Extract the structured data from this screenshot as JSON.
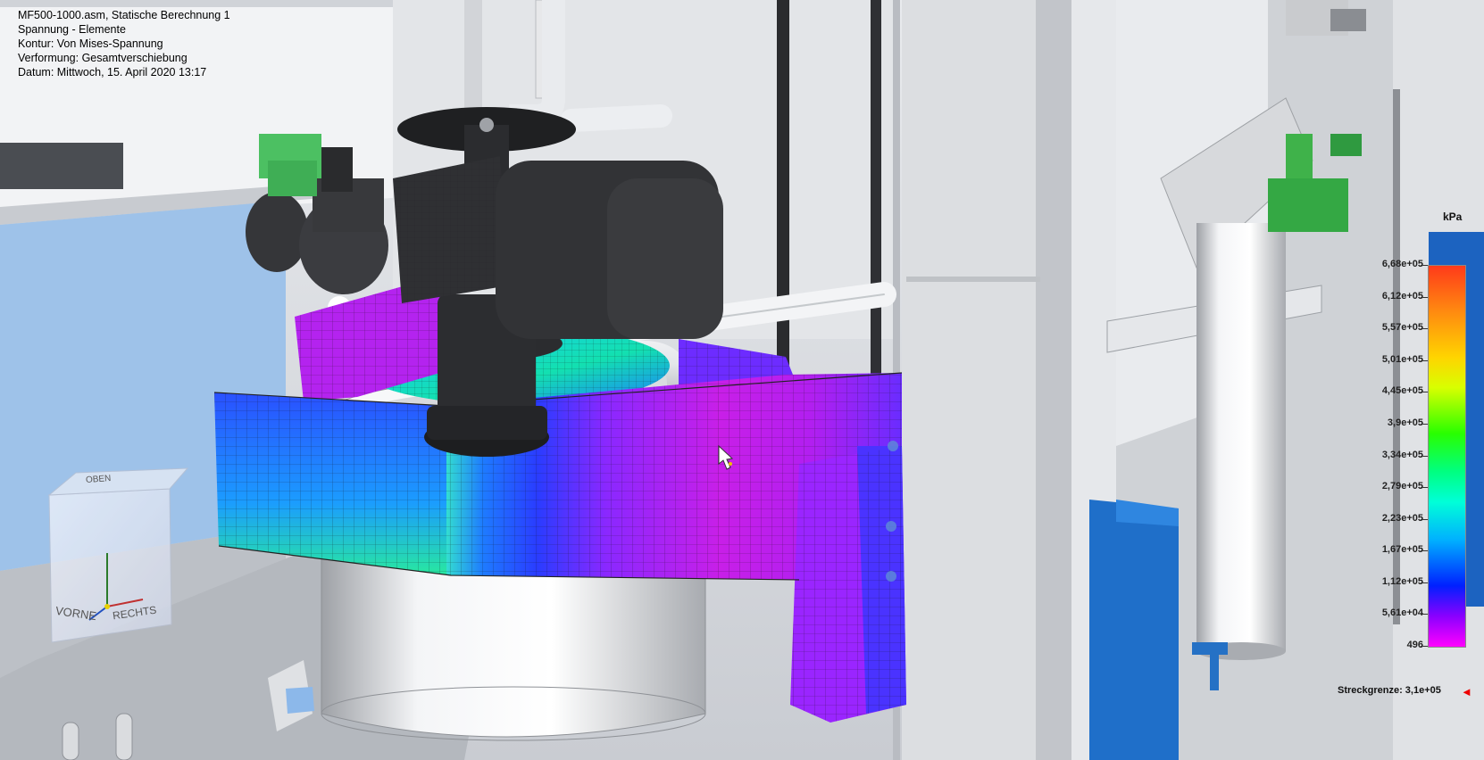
{
  "header": {
    "line1": "MF500-1000.asm, Statische Berechnung 1",
    "line2": "Spannung - Elemente",
    "line3": "Kontur: Von Mises-Spannung",
    "line4": "Verformung: Gesamtverschiebung",
    "line5": "Datum: Mittwoch, 15. April 2020  13:17"
  },
  "legend": {
    "unit": "kPa",
    "labels": [
      "6,68e+05",
      "6,12e+05",
      "5,57e+05",
      "5,01e+05",
      "4,45e+05",
      "3,9e+05",
      "3,34e+05",
      "2,79e+05",
      "2,23e+05",
      "1,67e+05",
      "1,12e+05",
      "5,61e+04",
      "496"
    ],
    "yield_label": "Streckgrenze: 3,1e+05",
    "yield_arrow": "◄"
  },
  "viewcube": {
    "top": "OBEN",
    "front": "VORNE",
    "right": "RECHTS"
  },
  "colors": {
    "background": "#d9dde3",
    "mesh_magenta": "#c81fe8",
    "mesh_blue": "#2f49ff",
    "motor_dark": "#2a2a2a",
    "valve_green": "#3fb24a",
    "panel_blue": "#1f6fc9"
  }
}
